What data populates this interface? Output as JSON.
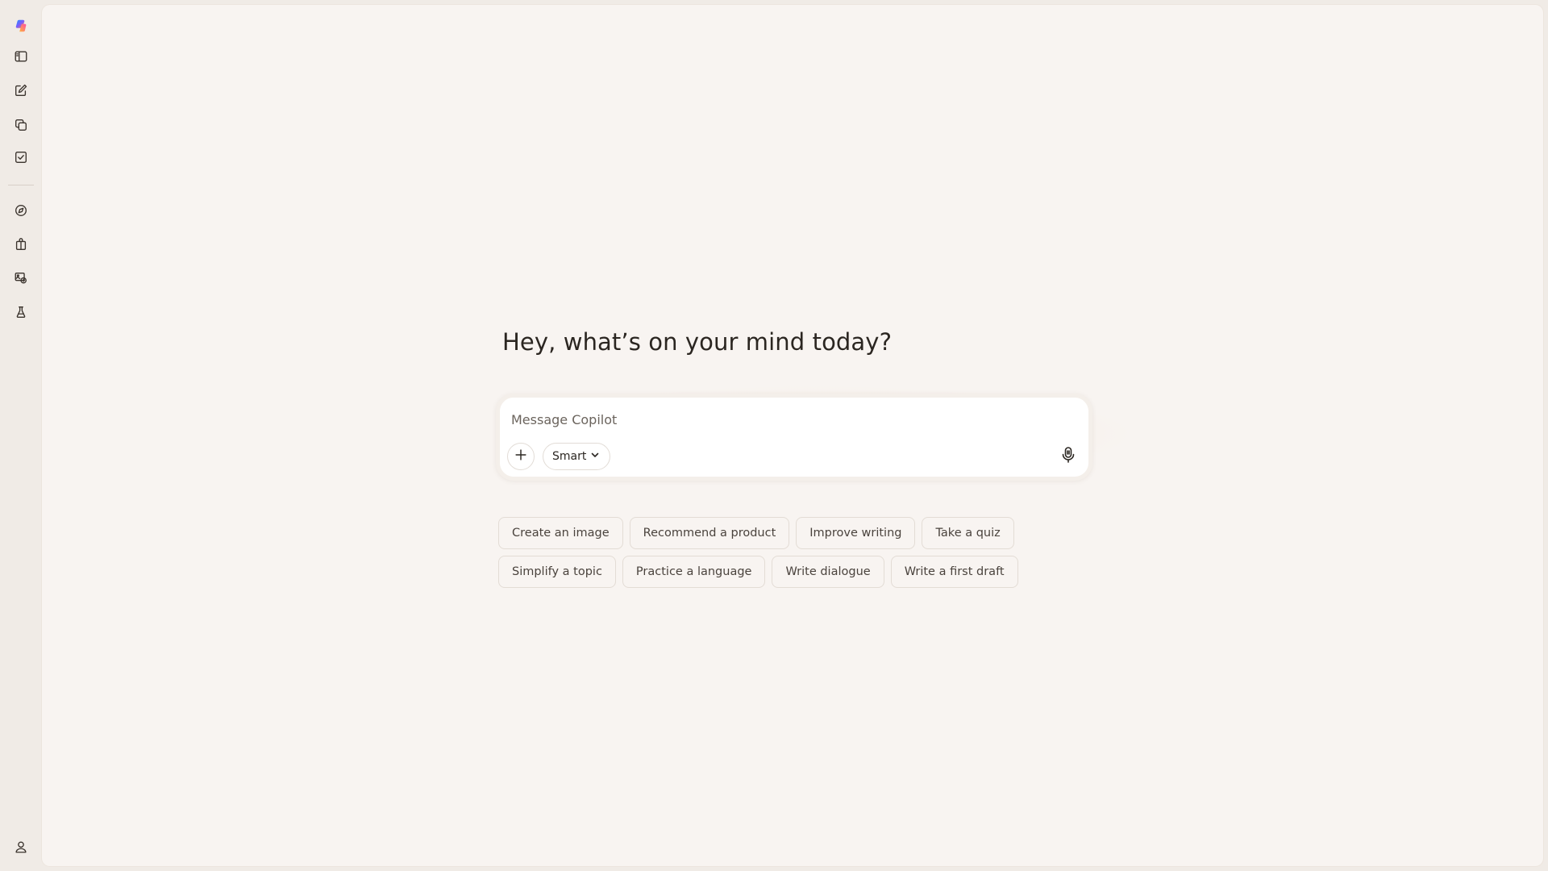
{
  "sidebar": {
    "top_items": [
      {
        "icon": "copilot-logo-icon",
        "label": "Copilot"
      },
      {
        "icon": "sidebar-toggle-icon",
        "label": "Toggle sidebar"
      },
      {
        "icon": "new-chat-icon",
        "label": "New chat"
      },
      {
        "icon": "copy-stack-icon",
        "label": "Library"
      },
      {
        "icon": "task-check-icon",
        "label": "Tasks"
      }
    ],
    "bottom_items": [
      {
        "icon": "explore-icon",
        "label": "Discover"
      },
      {
        "icon": "gift-icon",
        "label": "Offers"
      },
      {
        "icon": "image-gallery-icon",
        "label": "Images"
      },
      {
        "icon": "lab-flask-icon",
        "label": "Labs"
      }
    ],
    "profile_icon": "user-profile-icon"
  },
  "main": {
    "greeting": "Hey, what’s on your mind today?",
    "composer": {
      "placeholder": "Message Copilot",
      "value": "",
      "mode_label": "Smart"
    },
    "suggestions_row1": [
      "Create an image",
      "Recommend a product",
      "Improve writing",
      "Take a quiz"
    ],
    "suggestions_row2": [
      "Simplify a topic",
      "Practice a language",
      "Write dialogue",
      "Write a first draft"
    ]
  },
  "colors": {
    "outer_bg": "#f0ebe6",
    "panel_bg": "#f8f4f1",
    "text": "#2b2621"
  }
}
